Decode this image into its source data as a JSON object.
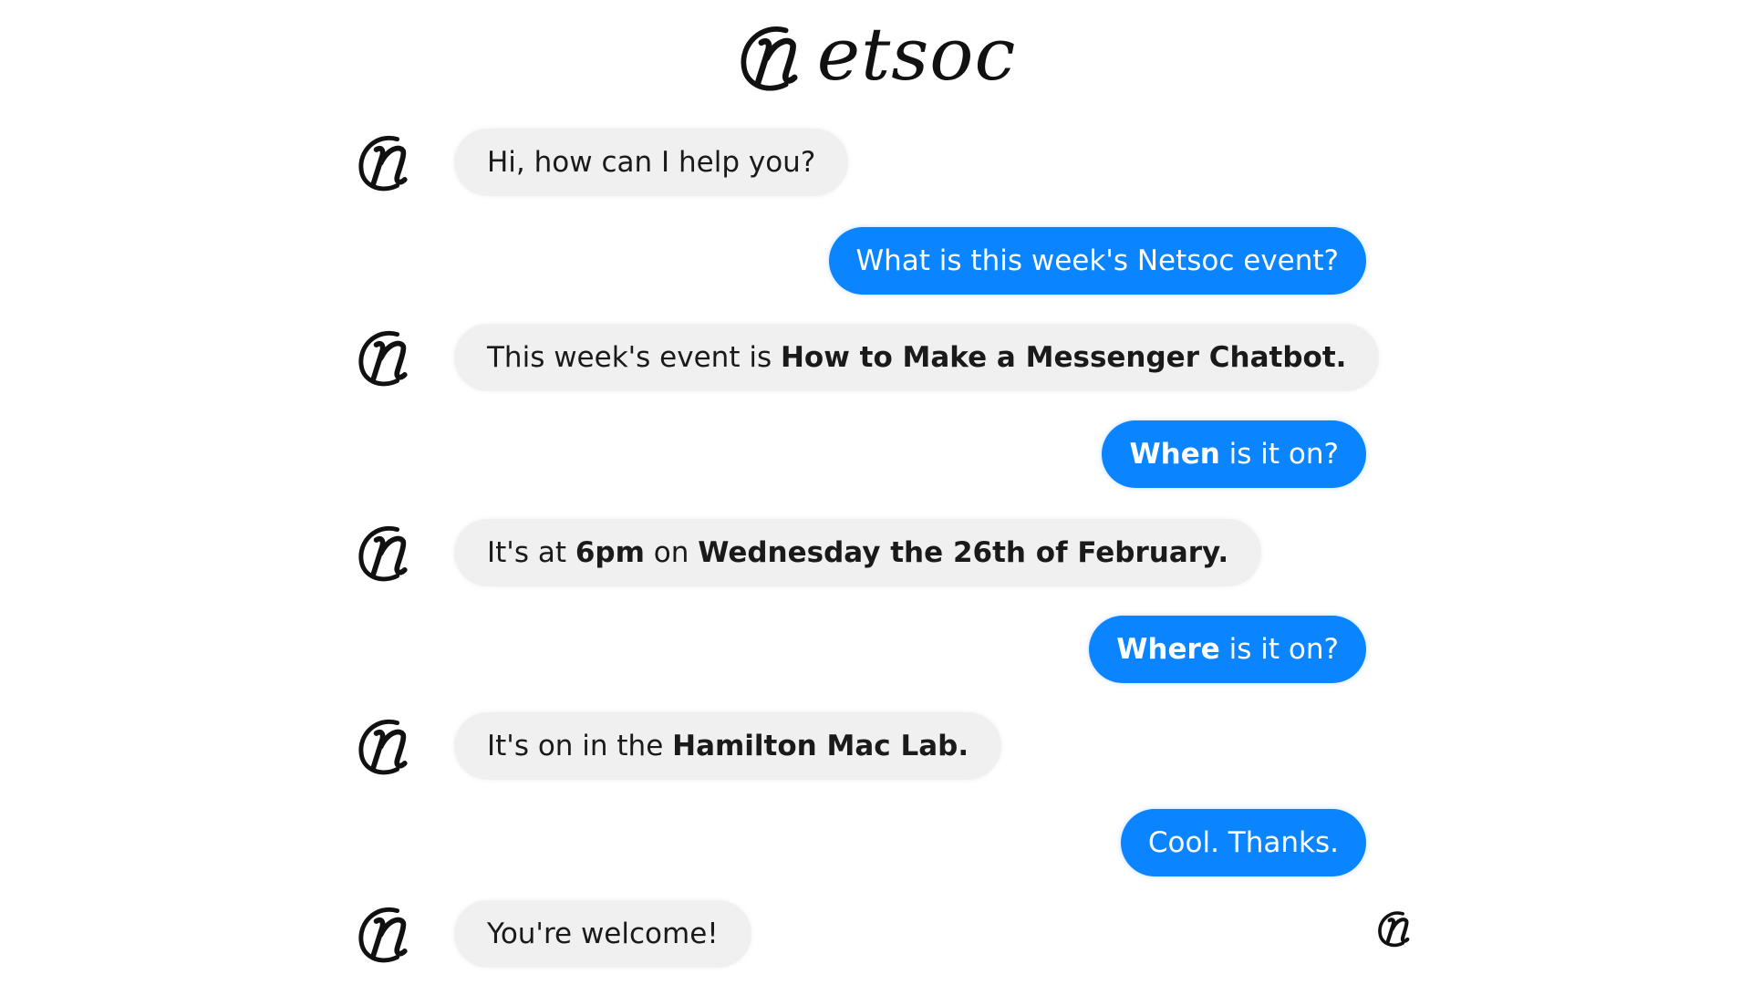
{
  "header": {
    "brand_text": "etsoc",
    "logo_icon": "netsoc-n-logo-icon"
  },
  "messages": [
    {
      "sender": "bot",
      "parts": [
        {
          "text": "Hi, how can I help you?",
          "bold": false
        }
      ]
    },
    {
      "sender": "user",
      "parts": [
        {
          "text": "What is this week's Netsoc event?",
          "bold": false
        }
      ]
    },
    {
      "sender": "bot",
      "parts": [
        {
          "text": "This week's event is ",
          "bold": false
        },
        {
          "text": "How to Make a Messenger Chatbot.",
          "bold": true
        }
      ]
    },
    {
      "sender": "user",
      "parts": [
        {
          "text": "When",
          "bold": true
        },
        {
          "text": " is it on?",
          "bold": false
        }
      ]
    },
    {
      "sender": "bot",
      "parts": [
        {
          "text": "It's at ",
          "bold": false
        },
        {
          "text": "6pm",
          "bold": true
        },
        {
          "text": " on ",
          "bold": false
        },
        {
          "text": "Wednesday the 26th of February.",
          "bold": true
        }
      ]
    },
    {
      "sender": "user",
      "parts": [
        {
          "text": "Where",
          "bold": true
        },
        {
          "text": " is it on?",
          "bold": false
        }
      ]
    },
    {
      "sender": "bot",
      "parts": [
        {
          "text": "It's on in the ",
          "bold": false
        },
        {
          "text": "Hamilton Mac Lab.",
          "bold": true
        }
      ]
    },
    {
      "sender": "user",
      "parts": [
        {
          "text": "Cool. Thanks.",
          "bold": false
        }
      ]
    },
    {
      "sender": "bot",
      "parts": [
        {
          "text": "You're welcome!",
          "bold": false
        }
      ]
    }
  ],
  "colors": {
    "user_bubble": "#0b84ff",
    "bot_bubble": "#f0f0f0"
  }
}
